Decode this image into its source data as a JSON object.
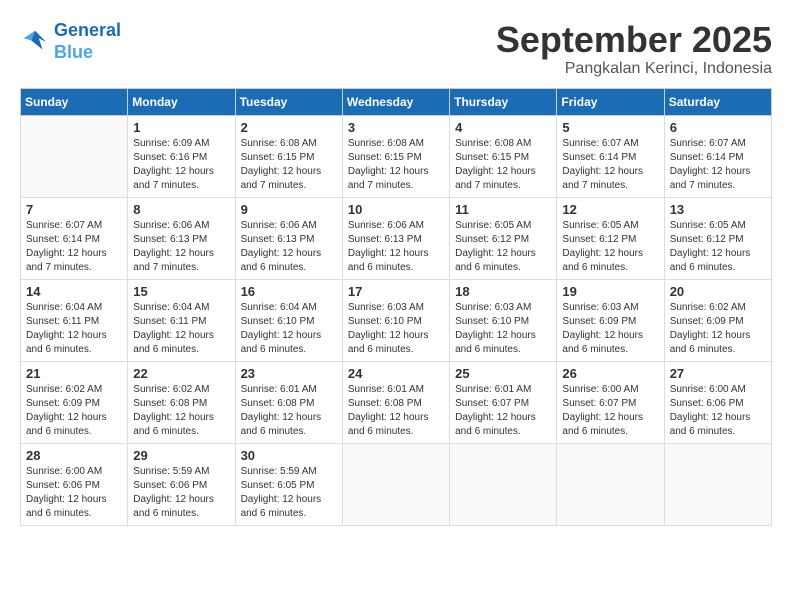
{
  "logo": {
    "line1": "General",
    "line2": "Blue"
  },
  "header": {
    "month": "September 2025",
    "location": "Pangkalan Kerinci, Indonesia"
  },
  "weekdays": [
    "Sunday",
    "Monday",
    "Tuesday",
    "Wednesday",
    "Thursday",
    "Friday",
    "Saturday"
  ],
  "weeks": [
    [
      {
        "day": "",
        "text": ""
      },
      {
        "day": "1",
        "text": "Sunrise: 6:09 AM\nSunset: 6:16 PM\nDaylight: 12 hours\nand 7 minutes."
      },
      {
        "day": "2",
        "text": "Sunrise: 6:08 AM\nSunset: 6:15 PM\nDaylight: 12 hours\nand 7 minutes."
      },
      {
        "day": "3",
        "text": "Sunrise: 6:08 AM\nSunset: 6:15 PM\nDaylight: 12 hours\nand 7 minutes."
      },
      {
        "day": "4",
        "text": "Sunrise: 6:08 AM\nSunset: 6:15 PM\nDaylight: 12 hours\nand 7 minutes."
      },
      {
        "day": "5",
        "text": "Sunrise: 6:07 AM\nSunset: 6:14 PM\nDaylight: 12 hours\nand 7 minutes."
      },
      {
        "day": "6",
        "text": "Sunrise: 6:07 AM\nSunset: 6:14 PM\nDaylight: 12 hours\nand 7 minutes."
      }
    ],
    [
      {
        "day": "7",
        "text": "Sunrise: 6:07 AM\nSunset: 6:14 PM\nDaylight: 12 hours\nand 7 minutes."
      },
      {
        "day": "8",
        "text": "Sunrise: 6:06 AM\nSunset: 6:13 PM\nDaylight: 12 hours\nand 7 minutes."
      },
      {
        "day": "9",
        "text": "Sunrise: 6:06 AM\nSunset: 6:13 PM\nDaylight: 12 hours\nand 6 minutes."
      },
      {
        "day": "10",
        "text": "Sunrise: 6:06 AM\nSunset: 6:13 PM\nDaylight: 12 hours\nand 6 minutes."
      },
      {
        "day": "11",
        "text": "Sunrise: 6:05 AM\nSunset: 6:12 PM\nDaylight: 12 hours\nand 6 minutes."
      },
      {
        "day": "12",
        "text": "Sunrise: 6:05 AM\nSunset: 6:12 PM\nDaylight: 12 hours\nand 6 minutes."
      },
      {
        "day": "13",
        "text": "Sunrise: 6:05 AM\nSunset: 6:12 PM\nDaylight: 12 hours\nand 6 minutes."
      }
    ],
    [
      {
        "day": "14",
        "text": "Sunrise: 6:04 AM\nSunset: 6:11 PM\nDaylight: 12 hours\nand 6 minutes."
      },
      {
        "day": "15",
        "text": "Sunrise: 6:04 AM\nSunset: 6:11 PM\nDaylight: 12 hours\nand 6 minutes."
      },
      {
        "day": "16",
        "text": "Sunrise: 6:04 AM\nSunset: 6:10 PM\nDaylight: 12 hours\nand 6 minutes."
      },
      {
        "day": "17",
        "text": "Sunrise: 6:03 AM\nSunset: 6:10 PM\nDaylight: 12 hours\nand 6 minutes."
      },
      {
        "day": "18",
        "text": "Sunrise: 6:03 AM\nSunset: 6:10 PM\nDaylight: 12 hours\nand 6 minutes."
      },
      {
        "day": "19",
        "text": "Sunrise: 6:03 AM\nSunset: 6:09 PM\nDaylight: 12 hours\nand 6 minutes."
      },
      {
        "day": "20",
        "text": "Sunrise: 6:02 AM\nSunset: 6:09 PM\nDaylight: 12 hours\nand 6 minutes."
      }
    ],
    [
      {
        "day": "21",
        "text": "Sunrise: 6:02 AM\nSunset: 6:09 PM\nDaylight: 12 hours\nand 6 minutes."
      },
      {
        "day": "22",
        "text": "Sunrise: 6:02 AM\nSunset: 6:08 PM\nDaylight: 12 hours\nand 6 minutes."
      },
      {
        "day": "23",
        "text": "Sunrise: 6:01 AM\nSunset: 6:08 PM\nDaylight: 12 hours\nand 6 minutes."
      },
      {
        "day": "24",
        "text": "Sunrise: 6:01 AM\nSunset: 6:08 PM\nDaylight: 12 hours\nand 6 minutes."
      },
      {
        "day": "25",
        "text": "Sunrise: 6:01 AM\nSunset: 6:07 PM\nDaylight: 12 hours\nand 6 minutes."
      },
      {
        "day": "26",
        "text": "Sunrise: 6:00 AM\nSunset: 6:07 PM\nDaylight: 12 hours\nand 6 minutes."
      },
      {
        "day": "27",
        "text": "Sunrise: 6:00 AM\nSunset: 6:06 PM\nDaylight: 12 hours\nand 6 minutes."
      }
    ],
    [
      {
        "day": "28",
        "text": "Sunrise: 6:00 AM\nSunset: 6:06 PM\nDaylight: 12 hours\nand 6 minutes."
      },
      {
        "day": "29",
        "text": "Sunrise: 5:59 AM\nSunset: 6:06 PM\nDaylight: 12 hours\nand 6 minutes."
      },
      {
        "day": "30",
        "text": "Sunrise: 5:59 AM\nSunset: 6:05 PM\nDaylight: 12 hours\nand 6 minutes."
      },
      {
        "day": "",
        "text": ""
      },
      {
        "day": "",
        "text": ""
      },
      {
        "day": "",
        "text": ""
      },
      {
        "day": "",
        "text": ""
      }
    ]
  ]
}
